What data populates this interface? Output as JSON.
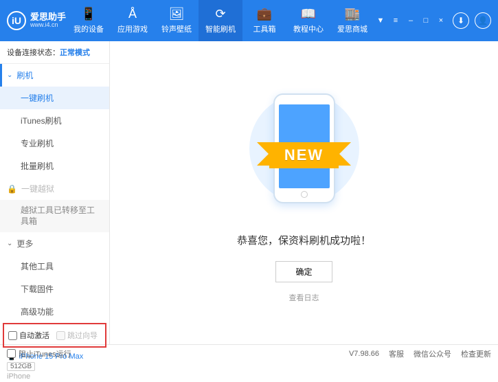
{
  "app": {
    "title": "爱思助手",
    "url": "www.i4.cn"
  },
  "nav": {
    "items": [
      {
        "label": "我的设备"
      },
      {
        "label": "应用游戏"
      },
      {
        "label": "铃声壁纸"
      },
      {
        "label": "智能刷机"
      },
      {
        "label": "工具箱"
      },
      {
        "label": "教程中心"
      },
      {
        "label": "爱思商城"
      }
    ]
  },
  "status": {
    "prefix": "设备连接状态：",
    "mode": "正常模式"
  },
  "sidebar": {
    "flash_head": "刷机",
    "flash_items": [
      "一键刷机",
      "iTunes刷机",
      "专业刷机",
      "批量刷机"
    ],
    "jailbreak": "一键越狱",
    "jailbreak_note": "越狱工具已转移至工具箱",
    "more_head": "更多",
    "more_items": [
      "其他工具",
      "下载固件",
      "高级功能"
    ],
    "auto_activate": "自动激活",
    "skip_guide": "跳过向导"
  },
  "device": {
    "name": "iPhone 15 Pro Max",
    "capacity": "512GB",
    "model": "iPhone"
  },
  "main": {
    "ribbon": "NEW",
    "message": "恭喜您，保资料刷机成功啦！",
    "ok": "确定",
    "view_log": "查看日志"
  },
  "footer": {
    "block_itunes": "阻止iTunes运行",
    "version": "V7.98.66",
    "links": [
      "客服",
      "微信公众号",
      "检查更新"
    ]
  }
}
